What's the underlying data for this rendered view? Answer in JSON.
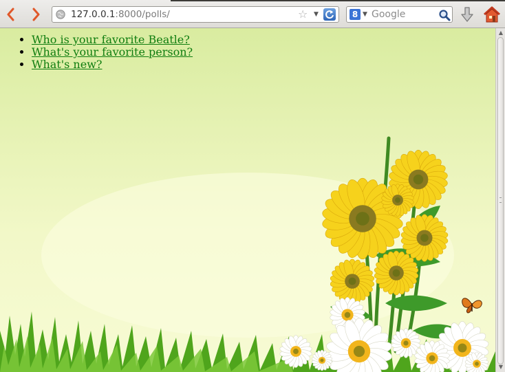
{
  "browser": {
    "url_host": "127.0.0.1",
    "url_rest": ":8000/polls/",
    "search_placeholder": "Google",
    "search_engine_letter": "8"
  },
  "polls": [
    {
      "question": "Who is your favorite Beatle?"
    },
    {
      "question": "What's your favorite person?"
    },
    {
      "question": "What's new?"
    }
  ],
  "colors": {
    "link": "#0f7d0f",
    "page_bg_top": "#d9eca0",
    "page_bg_bottom": "#f7fbd4",
    "sunflower_petal": "#f6d21c",
    "sunflower_center": "#8a7a20",
    "grass": "#4fa51c"
  },
  "icons": [
    "back-arrow-icon",
    "forward-arrow-icon",
    "globe-icon",
    "bookmark-star-icon",
    "reload-icon",
    "google-icon",
    "search-icon",
    "download-icon",
    "home-icon"
  ],
  "background_art": "sunflowers, daisies and grass with a butterfly"
}
